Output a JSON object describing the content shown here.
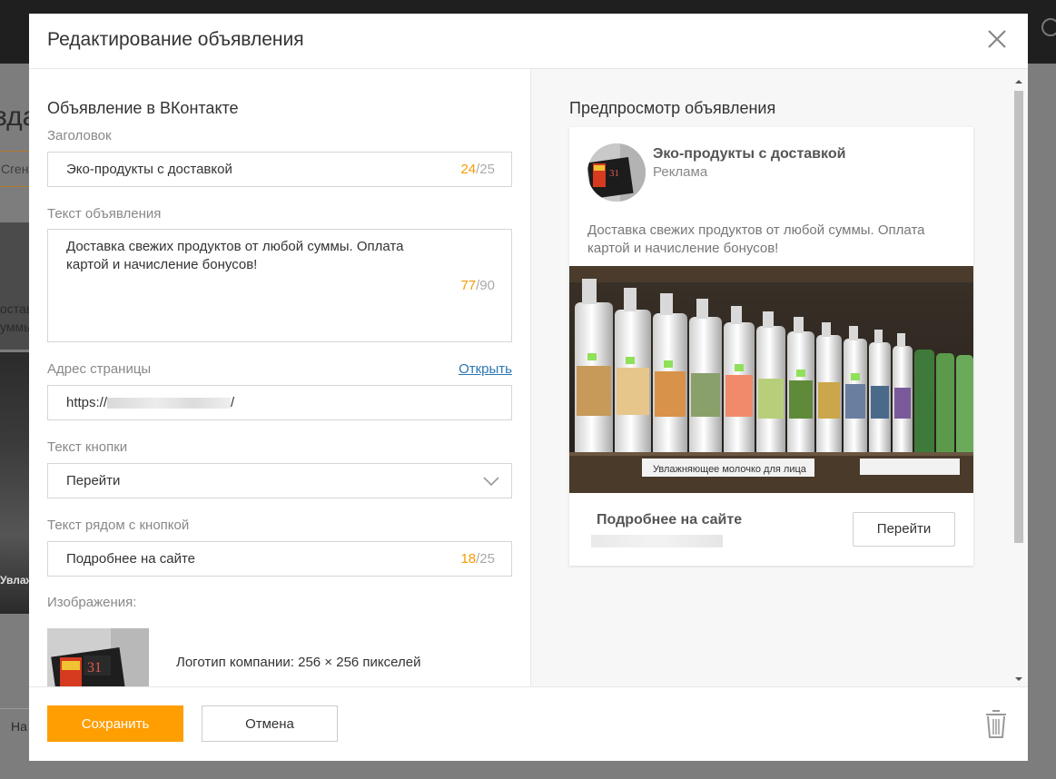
{
  "background": {
    "title_fragment": "зда",
    "button_fragment": "Сгене",
    "card_text": [
      "остав",
      "уммы"
    ],
    "photo_label": "Увлаж",
    "nav_fragment": "На"
  },
  "modal": {
    "title": "Редактирование объявления",
    "section_title": "Объявление в ВКонтакте",
    "fields": {
      "headline": {
        "label": "Заголовок",
        "value": "Эко-продукты с доставкой",
        "count": "24",
        "max": "/25"
      },
      "text": {
        "label": "Текст объявления",
        "value": "Доставка свежих продуктов от любой суммы. Оплата картой и начисление бонусов!",
        "count": "77",
        "max": "/90"
      },
      "url": {
        "label": "Адрес страницы",
        "link": "Открыть",
        "value_prefix": "https://",
        "value_suffix": "/"
      },
      "button_text": {
        "label": "Текст кнопки",
        "value": "Перейти"
      },
      "near_button": {
        "label": "Текст рядом с кнопкой",
        "value": "Подробнее на сайте",
        "count": "18",
        "max": "/25"
      },
      "images": {
        "label": "Изображения:",
        "logo_caption": "Логотип компании: 256 × 256 пикселей"
      }
    },
    "preview": {
      "title": "Предпросмотр объявления",
      "name": "Эко-продукты с доставкой",
      "sub": "Реклама",
      "text": "Доставка свежих продуктов от любой суммы. Оплата картой и начисление бонусов!",
      "shelf_label": "Увлажняющее молочко для лица",
      "bottom_text": "Подробнее на сайте",
      "button": "Перейти"
    },
    "footer": {
      "save": "Сохранить",
      "cancel": "Отмена"
    }
  },
  "colors": {
    "accent": "#ff9e00",
    "counter": "#f59b00",
    "link": "#2a76b3"
  }
}
